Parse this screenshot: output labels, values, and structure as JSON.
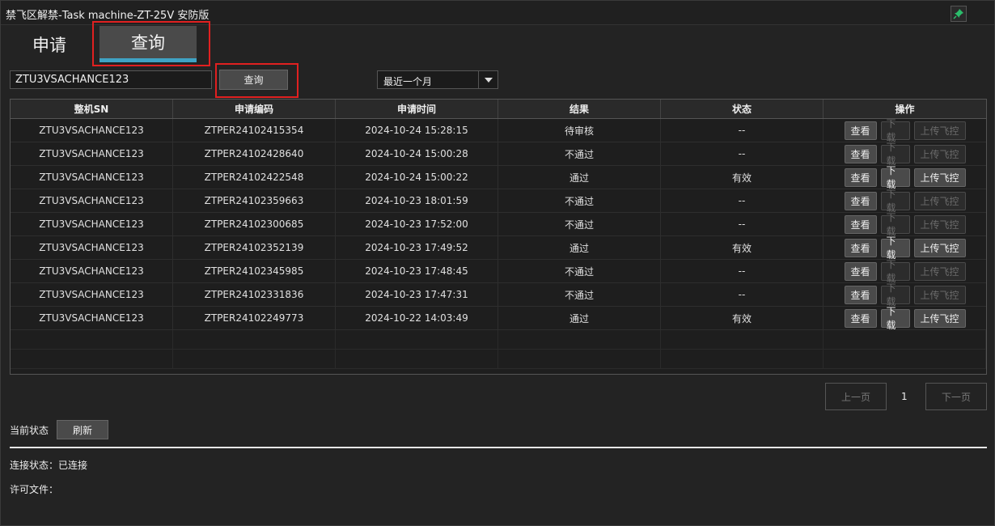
{
  "window": {
    "title": "禁飞区解禁-Task machine-ZT-25V 安防版"
  },
  "tabs": [
    {
      "label": "申请"
    },
    {
      "label": "查询"
    }
  ],
  "search": {
    "value": "ZTU3VSACHANCE123",
    "button_label": "查询"
  },
  "range": {
    "selected": "最近一个月"
  },
  "table": {
    "headers": [
      "整机SN",
      "申请编码",
      "申请时间",
      "结果",
      "状态",
      "操作"
    ],
    "action_labels": {
      "view": "查看",
      "download": "下载",
      "upload": "上传飞控"
    },
    "rows": [
      {
        "sn": "ZTU3VSACHANCE123",
        "code": "ZTPER24102415354",
        "time": "2024-10-24 15:28:15",
        "result": "待审核",
        "status": "--",
        "enabled": false
      },
      {
        "sn": "ZTU3VSACHANCE123",
        "code": "ZTPER24102428640",
        "time": "2024-10-24 15:00:28",
        "result": "不通过",
        "status": "--",
        "enabled": false
      },
      {
        "sn": "ZTU3VSACHANCE123",
        "code": "ZTPER24102422548",
        "time": "2024-10-24 15:00:22",
        "result": "通过",
        "status": "有效",
        "enabled": true
      },
      {
        "sn": "ZTU3VSACHANCE123",
        "code": "ZTPER24102359663",
        "time": "2024-10-23 18:01:59",
        "result": "不通过",
        "status": "--",
        "enabled": false
      },
      {
        "sn": "ZTU3VSACHANCE123",
        "code": "ZTPER24102300685",
        "time": "2024-10-23 17:52:00",
        "result": "不通过",
        "status": "--",
        "enabled": false
      },
      {
        "sn": "ZTU3VSACHANCE123",
        "code": "ZTPER24102352139",
        "time": "2024-10-23 17:49:52",
        "result": "通过",
        "status": "有效",
        "enabled": true
      },
      {
        "sn": "ZTU3VSACHANCE123",
        "code": "ZTPER24102345985",
        "time": "2024-10-23 17:48:45",
        "result": "不通过",
        "status": "--",
        "enabled": false
      },
      {
        "sn": "ZTU3VSACHANCE123",
        "code": "ZTPER24102331836",
        "time": "2024-10-23 17:47:31",
        "result": "不通过",
        "status": "--",
        "enabled": false
      },
      {
        "sn": "ZTU3VSACHANCE123",
        "code": "ZTPER24102249773",
        "time": "2024-10-22 14:03:49",
        "result": "通过",
        "status": "有效",
        "enabled": true
      }
    ]
  },
  "pager": {
    "prev": "上一页",
    "page": "1",
    "next": "下一页"
  },
  "footer": {
    "current_status": "当前状态",
    "refresh": "刷新",
    "connection": "连接状态：已连接",
    "license": "许可文件："
  },
  "colors": {
    "accent": "#3fa3c4",
    "highlight": "#e02020",
    "background": "#232323"
  },
  "icons": {
    "pin": "pin-icon",
    "dropdown": "chevron-down-icon"
  }
}
